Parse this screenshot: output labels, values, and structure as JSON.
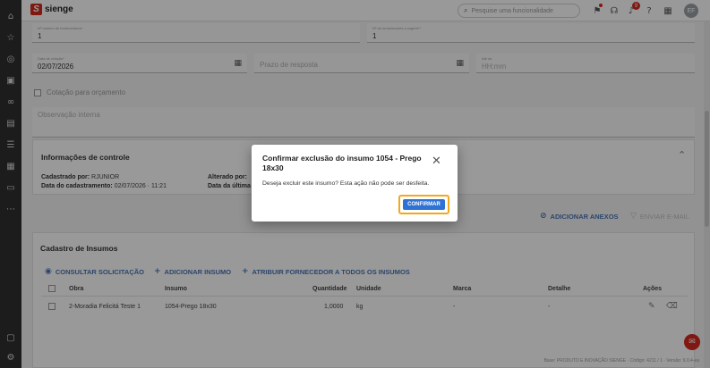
{
  "header": {
    "logo_text": "sienge",
    "search_placeholder": "Pesquise uma funcionalidade",
    "notification_count": "9",
    "avatar_initials": "EF"
  },
  "form": {
    "min_suppliers_label": "Nº mínimo de fornecedores*",
    "min_suppliers_value": "1",
    "max_suppliers_label": "Nº de fornecedores a sugerir**",
    "max_suppliers_value": "1",
    "created_date_label": "Data de criação*",
    "created_date_value": "02/07/2026",
    "response_deadline_placeholder": "Prazo de resposta",
    "time_label": "Até às",
    "time_placeholder": "HH:mm",
    "budget_quote_label": "Cotação para orçamento",
    "internal_note_placeholder": "Observação interna"
  },
  "control_info": {
    "title": "Informações de controle",
    "registered_by_label": "Cadastrado por:",
    "registered_by_value": "RJUNIOR",
    "registered_date_label": "Data do cadastramento:",
    "registered_date_value": "02/07/2026 · 11:21",
    "changed_by_label": "Alterado por:",
    "changed_by_value": "",
    "last_label": "Data da última"
  },
  "actions": {
    "add_attachments": "ADICIONAR ANEXOS",
    "send_email": "ENVIAR E-MAIL"
  },
  "inputs_section": {
    "title": "Cadastro de Insumos",
    "consult_request": "CONSULTAR SOLICITAÇÃO",
    "add_input": "ADICIONAR INSUMO",
    "assign_supplier": "ATRIBUIR FORNECEDOR A TODOS OS INSUMOS",
    "columns": {
      "work": "Obra",
      "input": "Insumo",
      "quantity": "Quantidade",
      "unit": "Unidade",
      "brand": "Marca",
      "detail": "Detalhe",
      "actions": "Ações"
    },
    "rows": [
      {
        "work": "2-Moradia Felicitá Teste 1",
        "input": "1054-Prego 18x30",
        "quantity": "1,0000",
        "unit": "kg",
        "brand": "-",
        "detail": "-"
      }
    ]
  },
  "footer": {
    "text": "Base: PRODUTO E INOVAÇÃO SIENGE · Código: 4211 / 1 · Versão: 9.0.4-ea"
  },
  "dialog": {
    "title": "Confirmar exclusão do insumo 1054 - Prego 18x30",
    "message": "Deseja excluir este insumo? Esta ação não pode ser desfeita.",
    "confirm_label": "CONFIRMAR"
  },
  "colors": {
    "brand_red": "#d6281f",
    "primary_blue": "#2f72d6",
    "link_blue": "#4a74b5",
    "highlight_orange": "#f3a81c"
  }
}
